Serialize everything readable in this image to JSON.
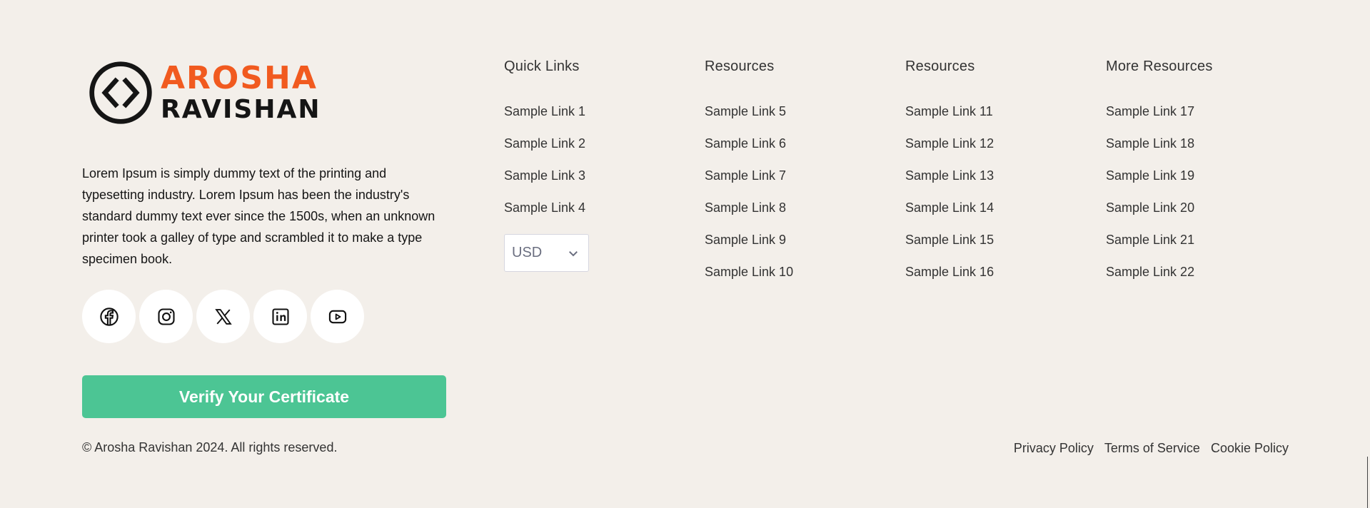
{
  "brand": {
    "logo_line1": "AROSHA",
    "logo_line2": "RAVISHAN",
    "about": "Lorem Ipsum is simply dummy text of the printing and typesetting industry. Lorem Ipsum has been the industry's standard dummy text ever since the 1500s, when an unknown printer took a galley of type and scrambled it to make a type specimen book.",
    "accent_color": "#f15a1f"
  },
  "socials": [
    {
      "icon": "facebook-icon"
    },
    {
      "icon": "instagram-icon"
    },
    {
      "icon": "x-icon"
    },
    {
      "icon": "linkedin-icon"
    },
    {
      "icon": "youtube-icon"
    }
  ],
  "verify_button": {
    "label": "Verify Your Certificate",
    "color": "#4cc594"
  },
  "columns": [
    {
      "heading": "Quick Links",
      "links": [
        "Sample Link 1",
        "Sample Link 2",
        "Sample Link 3",
        "Sample Link 4"
      ]
    },
    {
      "heading": "Resources",
      "links": [
        "Sample Link 5",
        "Sample Link 6",
        "Sample Link 7",
        "Sample Link 8",
        "Sample Link 9",
        "Sample Link 10"
      ]
    },
    {
      "heading": "Resources",
      "links": [
        "Sample Link 11",
        "Sample Link 12",
        "Sample Link 13",
        "Sample Link 14",
        "Sample Link 15",
        "Sample Link 16"
      ]
    },
    {
      "heading": "More Resources",
      "links": [
        "Sample Link 17",
        "Sample Link 18",
        "Sample Link 19",
        "Sample Link 20",
        "Sample Link 21",
        "Sample Link 22"
      ]
    }
  ],
  "currency": {
    "selected": "USD"
  },
  "footer": {
    "copyright": "© Arosha Ravishan 2024. All rights reserved.",
    "legal": [
      "Privacy Policy",
      "Terms of Service",
      "Cookie Policy"
    ]
  }
}
